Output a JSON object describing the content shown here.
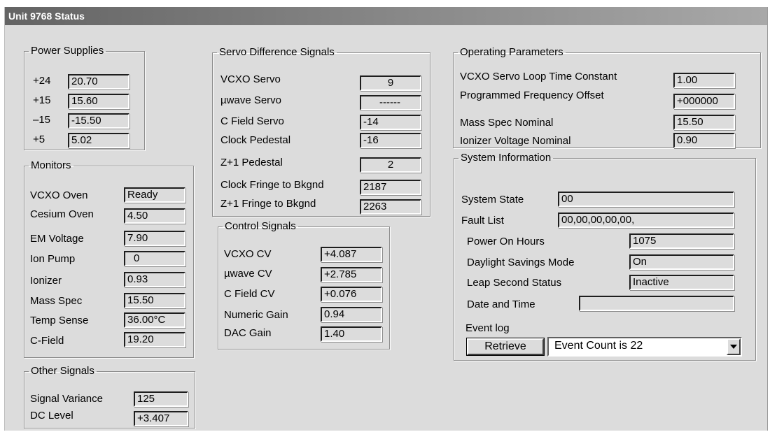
{
  "window": {
    "title": "Unit 9768 Status"
  },
  "power_supplies": {
    "legend": "Power Supplies",
    "rows": [
      {
        "label": "+24",
        "value": "20.70"
      },
      {
        "label": "+15",
        "value": "15.60"
      },
      {
        "label": "–15",
        "value": "-15.50"
      },
      {
        "label": "+5",
        "value": "5.02"
      }
    ]
  },
  "monitors": {
    "legend": "Monitors",
    "rows": [
      {
        "label": "VCXO Oven",
        "value": "Ready"
      },
      {
        "label": "Cesium Oven",
        "value": "4.50"
      },
      {
        "label": "EM Voltage",
        "value": "7.90"
      },
      {
        "label": "Ion Pump",
        "value": "0"
      },
      {
        "label": "Ionizer",
        "value": "0.93"
      },
      {
        "label": "Mass Spec",
        "value": "15.50"
      },
      {
        "label": "Temp Sense",
        "value": "36.00°C"
      },
      {
        "label": "C-Field",
        "value": "19.20"
      }
    ]
  },
  "other_signals": {
    "legend": "Other Signals",
    "rows": [
      {
        "label": "Signal Variance",
        "value": "125"
      },
      {
        "label": "DC Level",
        "value": "+3.407"
      }
    ]
  },
  "servo": {
    "legend": "Servo Difference Signals",
    "rows": [
      {
        "label": "VCXO Servo",
        "value": "9"
      },
      {
        "label": "µwave Servo",
        "value": "------"
      },
      {
        "label": "C Field Servo",
        "value": "-14"
      },
      {
        "label": "Clock Pedestal",
        "value": "-16"
      },
      {
        "label": "Z+1 Pedestal",
        "value": "2"
      },
      {
        "label": "Clock Fringe to Bkgnd",
        "value": "2187"
      },
      {
        "label": "Z+1 Fringe to Bkgnd",
        "value": "2263"
      }
    ]
  },
  "control": {
    "legend": "Control Signals",
    "rows": [
      {
        "label": "VCXO CV",
        "value": "+4.087"
      },
      {
        "label": "µwave CV",
        "value": "+2.785"
      },
      {
        "label": "C Field CV",
        "value": "+0.076"
      },
      {
        "label": "Numeric Gain",
        "value": "0.94"
      },
      {
        "label": "DAC Gain",
        "value": "1.40"
      }
    ]
  },
  "operating": {
    "legend": "Operating Parameters",
    "rows": [
      {
        "label": "VCXO Servo Loop Time Constant",
        "value": "1.00"
      },
      {
        "label": "Programmed Frequency Offset",
        "value": "+000000"
      },
      {
        "label": "Mass Spec Nominal",
        "value": "15.50"
      },
      {
        "label": "Ionizer Voltage Nominal",
        "value": "0.90"
      }
    ]
  },
  "system_info": {
    "legend": "System Information",
    "system_state_label": "System State",
    "system_state": "00",
    "fault_list_label": "Fault List",
    "fault_list": "00,00,00,00,00,",
    "power_on_hours_label": "Power On Hours",
    "power_on_hours": "1075",
    "dst_label": "Daylight Savings Mode",
    "dst": "On",
    "leap_label": "Leap Second Status",
    "leap": "Inactive",
    "datetime_label": "Date and Time",
    "datetime": "",
    "event_log_label": "Event log",
    "retrieve_label": "Retrieve",
    "event_count": "Event Count is 22"
  },
  "icons": {
    "dropdown": "chevron-down-icon"
  }
}
